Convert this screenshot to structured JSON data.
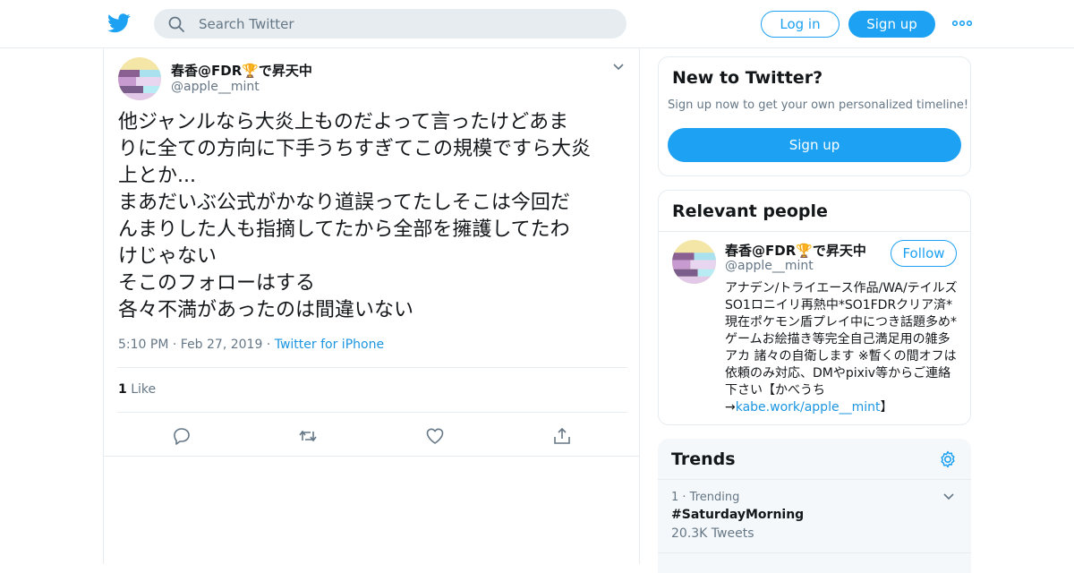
{
  "header": {
    "search_placeholder": "Search Twitter",
    "login_label": "Log in",
    "signup_label": "Sign up",
    "brand_color": "#1da1f2"
  },
  "tweet": {
    "author_name": "春香@FDR🏆で昇天中",
    "author_handle": "@apple__mint",
    "text": "他ジャンルなら大炎上ものだよって言ったけどあま\nりに全ての方向に下手うちすぎてこの規模ですら大炎\n上とか...\nまあだいぶ公式がかなり道誤ってたしそこは今回だ\nんまりした人も指摘してたから全部を擁護してたわ\nけじゃない\nそこのフォローはする\n各々不満があったのは間違いない",
    "time": "5:10 PM",
    "date": "Feb 27, 2019",
    "source": "Twitter for iPhone",
    "like_count": "1",
    "like_label": "Like"
  },
  "new_to_twitter": {
    "title": "New to Twitter?",
    "subtitle": "Sign up now to get your own personalized timeline!",
    "signup_label": "Sign up"
  },
  "relevant_people": {
    "title": "Relevant people",
    "name": "春香@FDR🏆で昇天中",
    "handle": "@apple__mint",
    "follow_label": "Follow",
    "bio": "アナデン/トライエース作品/WA/テイルズ SO1ロニイリ再熱中*SO1FDRクリア済*現在ポケモン盾プレイ中につき話題多め*ゲームお絵描き等完全自己満足用の雑多アカ 諸々の自衛します ※暫くの間オフは依頼のみ対応、DMやpixiv等からご連絡下さい【かべうち→",
    "bio_link": "kabe.work/apple__mint",
    "bio_end": "】"
  },
  "trends": {
    "title": "Trends",
    "items": [
      {
        "rank": "1 · Trending",
        "name": "#SaturdayMorning",
        "count": "20.3K Tweets"
      }
    ]
  }
}
